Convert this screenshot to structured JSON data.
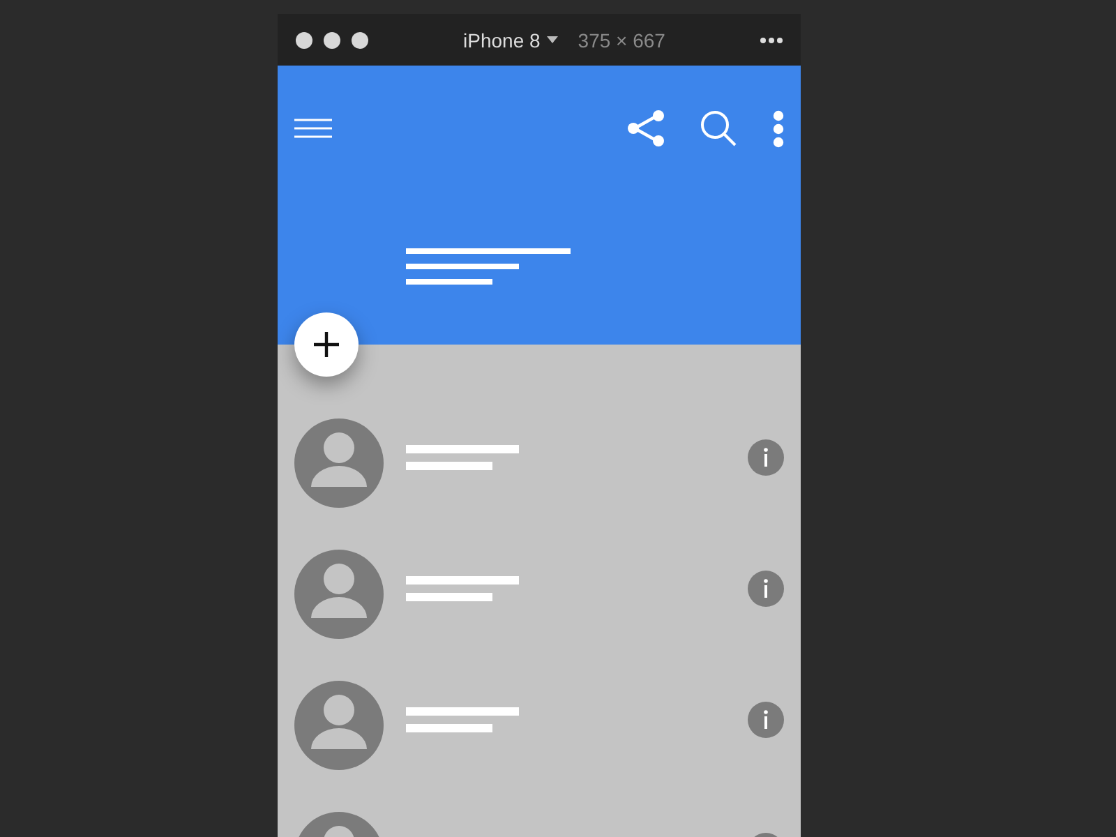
{
  "device_bar": {
    "device": "iPhone 8",
    "size": "375 × 667"
  },
  "contacts": [
    {
      "kind": "contact"
    },
    {
      "kind": "contact"
    },
    {
      "kind": "contact"
    },
    {
      "kind": "contact"
    }
  ]
}
